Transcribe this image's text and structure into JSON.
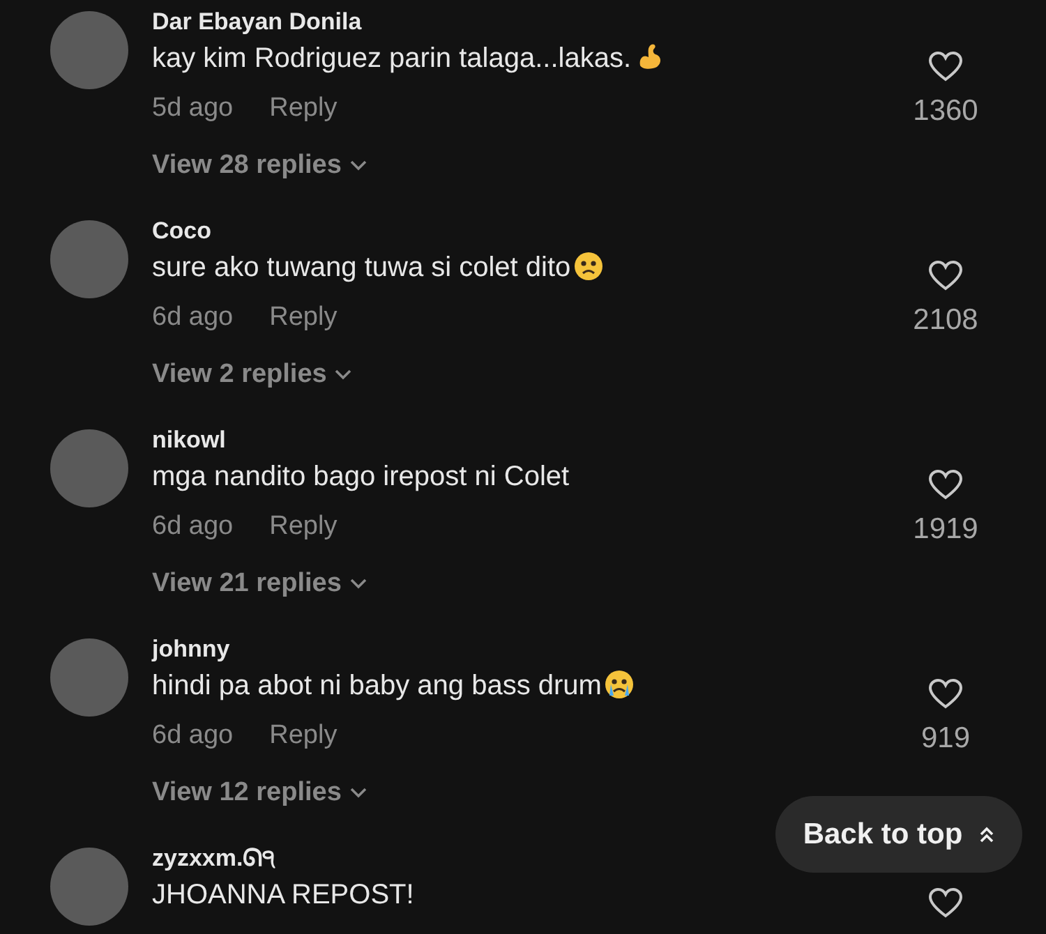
{
  "comments": [
    {
      "username": "Dar Ebayan Donila",
      "text": "kay kim Rodriguez parin talaga...lakas.",
      "kind": "muscle",
      "time": "5d ago",
      "reply": "Reply",
      "likes": "1360",
      "view_replies": "View 28 replies"
    },
    {
      "username": "Coco",
      "text": "sure ako tuwang tuwa si colet dito",
      "kind": "sad",
      "time": "6d ago",
      "reply": "Reply",
      "likes": "2108",
      "view_replies": "View 2 replies"
    },
    {
      "username": "nikowl",
      "text": "mga nandito bago irepost ni Colet",
      "kind": "plain",
      "time": "6d ago",
      "reply": "Reply",
      "likes": "1919",
      "view_replies": "View 21 replies"
    },
    {
      "username": "johnny",
      "text": "hindi pa abot ni baby ang bass drum",
      "kind": "crying",
      "time": "6d ago",
      "reply": "Reply",
      "likes": "919",
      "view_replies": "View 12 replies"
    },
    {
      "username": "zyzxxm.ᘏ੧",
      "text": "JHOANNA REPOST!",
      "kind": "plain"
    }
  ],
  "back_to_top": {
    "label": "Back to top"
  }
}
